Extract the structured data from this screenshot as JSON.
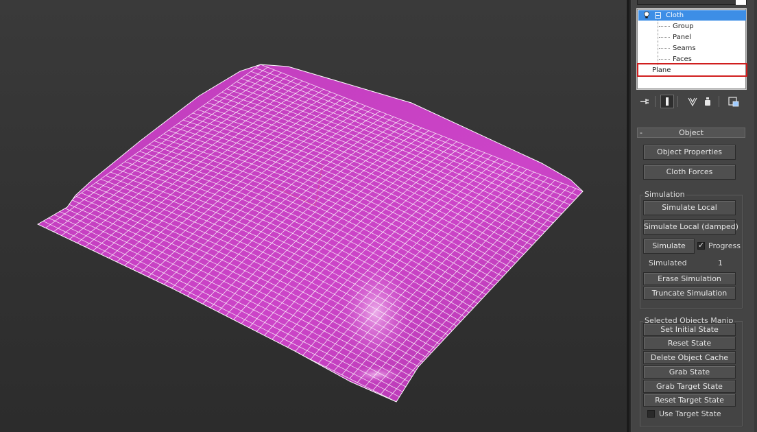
{
  "outliner": {
    "root_label": "Cloth",
    "children": [
      "Group",
      "Panel",
      "Seams",
      "Faces"
    ],
    "sibling_label": "Plane"
  },
  "icons": {
    "pin": "pin-stack-icon",
    "modifier": "show-end-result-icon",
    "make_unique": "make-unique-icon",
    "remove": "remove-modifier-icon",
    "configure": "configure-sets-icon"
  },
  "rollout": {
    "title": "Object",
    "collapse_glyph": "-",
    "object_properties": "Object Properties",
    "cloth_forces": "Cloth Forces"
  },
  "simulation": {
    "title": "Simulation",
    "simulate_local": "Simulate Local",
    "simulate_local_damped": "Simulate Local (damped)",
    "simulate": "Simulate",
    "progress_label": "Progress",
    "progress_checked": true,
    "simulated_label": "Simulated",
    "simulated_value": "1",
    "erase": "Erase Simulation",
    "truncate": "Truncate Simulation"
  },
  "selected_manip": {
    "title": "Selected Objects Manip",
    "set_initial": "Set Initial State",
    "reset_state": "Reset State",
    "delete_cache": "Delete Object Cache",
    "grab_state": "Grab State",
    "grab_target": "Grab Target State",
    "reset_target": "Reset Target State",
    "use_target_label": "Use Target State",
    "use_target_checked": false
  },
  "colors": {
    "selection": "#3d8ee6",
    "highlight_box": "#d01e1e",
    "cloth": "#c83ec3",
    "wire": "#ffffff"
  }
}
